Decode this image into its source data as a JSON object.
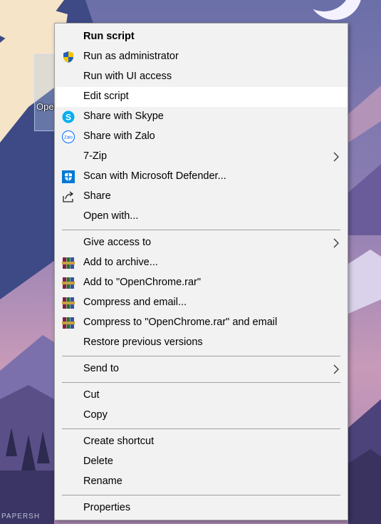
{
  "desktop": {
    "icon_label": "OpenChrome",
    "watermark": "PAPERSH"
  },
  "menu": {
    "items": [
      {
        "label": "Run script",
        "bold": true
      },
      {
        "label": "Run as administrator",
        "icon": "uac-shield-icon"
      },
      {
        "label": "Run with UI access"
      },
      {
        "label": "Edit script",
        "highlighted": true
      },
      {
        "label": "Share with Skype",
        "icon": "skype-icon"
      },
      {
        "label": "Share with Zalo",
        "icon": "zalo-icon"
      },
      {
        "label": "7-Zip",
        "submenu": true
      },
      {
        "label": "Scan with Microsoft Defender...",
        "icon": "defender-shield-icon"
      },
      {
        "label": "Share",
        "icon": "share-icon"
      },
      {
        "label": "Open with..."
      },
      {
        "label": "Give access to",
        "submenu": true
      },
      {
        "label": "Add to archive...",
        "icon": "winrar-icon"
      },
      {
        "label": "Add to \"OpenChrome.rar\"",
        "icon": "winrar-icon"
      },
      {
        "label": "Compress and email...",
        "icon": "winrar-icon"
      },
      {
        "label": "Compress to \"OpenChrome.rar\" and email",
        "icon": "winrar-icon"
      },
      {
        "label": "Restore previous versions"
      },
      {
        "label": "Send to",
        "submenu": true
      },
      {
        "label": "Cut"
      },
      {
        "label": "Copy"
      },
      {
        "label": "Create shortcut"
      },
      {
        "label": "Delete"
      },
      {
        "label": "Rename"
      },
      {
        "label": "Properties"
      }
    ]
  },
  "colors": {
    "menu_bg": "#f2f2f2",
    "hover_bg": "#ffffff",
    "separator": "#a0a0a0",
    "skype_blue": "#00aff0",
    "zalo_blue": "#0068ff",
    "defender_blue": "#0078d4"
  }
}
